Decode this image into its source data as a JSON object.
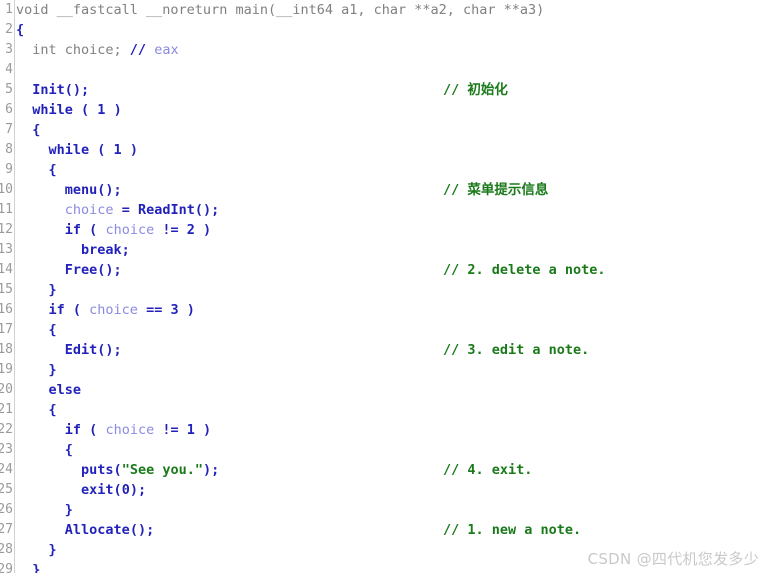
{
  "editor": {
    "kind": "hexrays-pseudocode-view",
    "background": "#ffffff",
    "gutter_color": "#9a9a9a",
    "comment_color": "#1a7a1a",
    "keyword_color": "#2222bb",
    "variable_color": "#8a8ae0",
    "plain_color": "#808080",
    "line_height_px": 20,
    "first_line_number": 1,
    "visible_lines": 29
  },
  "watermark": {
    "text": "CSDN @四代机您发多少"
  },
  "lines": [
    {
      "n": "1",
      "tokens": [
        {
          "t": "void __fastcall __noreturn main(__int64 a1, char **a2, char **a3)",
          "c": "t-plain"
        }
      ],
      "comment": ""
    },
    {
      "n": "2",
      "tokens": [
        {
          "t": "{",
          "c": "t-punct"
        }
      ],
      "comment": ""
    },
    {
      "n": "3",
      "tokens": [
        {
          "t": "  int choice; ",
          "c": "t-plain"
        },
        {
          "t": "// ",
          "c": "t-cmtmark"
        },
        {
          "t": "eax",
          "c": "t-cmt"
        }
      ],
      "comment": ""
    },
    {
      "n": "4",
      "tokens": [
        {
          "t": "",
          "c": "t-plain"
        }
      ],
      "comment": ""
    },
    {
      "n": "5",
      "tokens": [
        {
          "t": "  ",
          "c": "t-plain"
        },
        {
          "t": "Init",
          "c": "t-fn"
        },
        {
          "t": "();",
          "c": "t-punct"
        }
      ],
      "comment": "// 初始化"
    },
    {
      "n": "6",
      "tokens": [
        {
          "t": "  ",
          "c": "t-plain"
        },
        {
          "t": "while",
          "c": "t-kw"
        },
        {
          "t": " ( ",
          "c": "t-punct"
        },
        {
          "t": "1",
          "c": "t-num"
        },
        {
          "t": " )",
          "c": "t-punct"
        }
      ],
      "comment": ""
    },
    {
      "n": "7",
      "tokens": [
        {
          "t": "  ",
          "c": "t-plain"
        },
        {
          "t": "{",
          "c": "t-punct"
        }
      ],
      "comment": ""
    },
    {
      "n": "8",
      "tokens": [
        {
          "t": "    ",
          "c": "t-plain"
        },
        {
          "t": "while",
          "c": "t-kw"
        },
        {
          "t": " ( ",
          "c": "t-punct"
        },
        {
          "t": "1",
          "c": "t-num"
        },
        {
          "t": " )",
          "c": "t-punct"
        }
      ],
      "comment": ""
    },
    {
      "n": "9",
      "tokens": [
        {
          "t": "    ",
          "c": "t-plain"
        },
        {
          "t": "{",
          "c": "t-punct"
        }
      ],
      "comment": ""
    },
    {
      "n": "10",
      "tokens": [
        {
          "t": "      ",
          "c": "t-plain"
        },
        {
          "t": "menu",
          "c": "t-fn"
        },
        {
          "t": "();",
          "c": "t-punct"
        }
      ],
      "comment": "// 菜单提示信息"
    },
    {
      "n": "11",
      "tokens": [
        {
          "t": "      ",
          "c": "t-plain"
        },
        {
          "t": "choice",
          "c": "t-var"
        },
        {
          "t": " = ",
          "c": "t-punct"
        },
        {
          "t": "ReadInt",
          "c": "t-fn"
        },
        {
          "t": "();",
          "c": "t-punct"
        }
      ],
      "comment": ""
    },
    {
      "n": "12",
      "tokens": [
        {
          "t": "      ",
          "c": "t-plain"
        },
        {
          "t": "if",
          "c": "t-kw"
        },
        {
          "t": " ( ",
          "c": "t-punct"
        },
        {
          "t": "choice",
          "c": "t-var"
        },
        {
          "t": " != ",
          "c": "t-punct"
        },
        {
          "t": "2",
          "c": "t-num"
        },
        {
          "t": " )",
          "c": "t-punct"
        }
      ],
      "comment": ""
    },
    {
      "n": "13",
      "tokens": [
        {
          "t": "        ",
          "c": "t-plain"
        },
        {
          "t": "break",
          "c": "t-kw"
        },
        {
          "t": ";",
          "c": "t-punct"
        }
      ],
      "comment": ""
    },
    {
      "n": "14",
      "tokens": [
        {
          "t": "      ",
          "c": "t-plain"
        },
        {
          "t": "Free",
          "c": "t-fn"
        },
        {
          "t": "();",
          "c": "t-punct"
        }
      ],
      "comment": "// 2. delete a note."
    },
    {
      "n": "15",
      "tokens": [
        {
          "t": "    ",
          "c": "t-plain"
        },
        {
          "t": "}",
          "c": "t-punct"
        }
      ],
      "comment": ""
    },
    {
      "n": "16",
      "tokens": [
        {
          "t": "    ",
          "c": "t-plain"
        },
        {
          "t": "if",
          "c": "t-kw"
        },
        {
          "t": " ( ",
          "c": "t-punct"
        },
        {
          "t": "choice",
          "c": "t-var"
        },
        {
          "t": " == ",
          "c": "t-punct"
        },
        {
          "t": "3",
          "c": "t-num"
        },
        {
          "t": " )",
          "c": "t-punct"
        }
      ],
      "comment": ""
    },
    {
      "n": "17",
      "tokens": [
        {
          "t": "    ",
          "c": "t-plain"
        },
        {
          "t": "{",
          "c": "t-punct"
        }
      ],
      "comment": ""
    },
    {
      "n": "18",
      "tokens": [
        {
          "t": "      ",
          "c": "t-plain"
        },
        {
          "t": "Edit",
          "c": "t-fn"
        },
        {
          "t": "();",
          "c": "t-punct"
        }
      ],
      "comment": "// 3. edit a note."
    },
    {
      "n": "19",
      "tokens": [
        {
          "t": "    ",
          "c": "t-plain"
        },
        {
          "t": "}",
          "c": "t-punct"
        }
      ],
      "comment": ""
    },
    {
      "n": "20",
      "tokens": [
        {
          "t": "    ",
          "c": "t-plain"
        },
        {
          "t": "else",
          "c": "t-kw"
        }
      ],
      "comment": ""
    },
    {
      "n": "21",
      "tokens": [
        {
          "t": "    ",
          "c": "t-plain"
        },
        {
          "t": "{",
          "c": "t-punct"
        }
      ],
      "comment": ""
    },
    {
      "n": "22",
      "tokens": [
        {
          "t": "      ",
          "c": "t-plain"
        },
        {
          "t": "if",
          "c": "t-kw"
        },
        {
          "t": " ( ",
          "c": "t-punct"
        },
        {
          "t": "choice",
          "c": "t-var"
        },
        {
          "t": " != ",
          "c": "t-punct"
        },
        {
          "t": "1",
          "c": "t-num"
        },
        {
          "t": " )",
          "c": "t-punct"
        }
      ],
      "comment": ""
    },
    {
      "n": "23",
      "tokens": [
        {
          "t": "      ",
          "c": "t-plain"
        },
        {
          "t": "{",
          "c": "t-punct"
        }
      ],
      "comment": ""
    },
    {
      "n": "24",
      "tokens": [
        {
          "t": "        ",
          "c": "t-plain"
        },
        {
          "t": "puts",
          "c": "t-fn"
        },
        {
          "t": "(",
          "c": "t-punct"
        },
        {
          "t": "\"See you.\"",
          "c": "t-str"
        },
        {
          "t": ");",
          "c": "t-punct"
        }
      ],
      "comment": "// 4. exit."
    },
    {
      "n": "25",
      "tokens": [
        {
          "t": "        ",
          "c": "t-plain"
        },
        {
          "t": "exit",
          "c": "t-fn"
        },
        {
          "t": "(",
          "c": "t-punct"
        },
        {
          "t": "0",
          "c": "t-num"
        },
        {
          "t": ");",
          "c": "t-punct"
        }
      ],
      "comment": ""
    },
    {
      "n": "26",
      "tokens": [
        {
          "t": "      ",
          "c": "t-plain"
        },
        {
          "t": "}",
          "c": "t-punct"
        }
      ],
      "comment": ""
    },
    {
      "n": "27",
      "tokens": [
        {
          "t": "      ",
          "c": "t-plain"
        },
        {
          "t": "Allocate",
          "c": "t-fn"
        },
        {
          "t": "();",
          "c": "t-punct"
        }
      ],
      "comment": "// 1. new a note."
    },
    {
      "n": "28",
      "tokens": [
        {
          "t": "    ",
          "c": "t-plain"
        },
        {
          "t": "}",
          "c": "t-punct"
        }
      ],
      "comment": ""
    },
    {
      "n": "29",
      "tokens": [
        {
          "t": "  ",
          "c": "t-plain"
        },
        {
          "t": "}",
          "c": "t-punct"
        }
      ],
      "comment": ""
    }
  ]
}
